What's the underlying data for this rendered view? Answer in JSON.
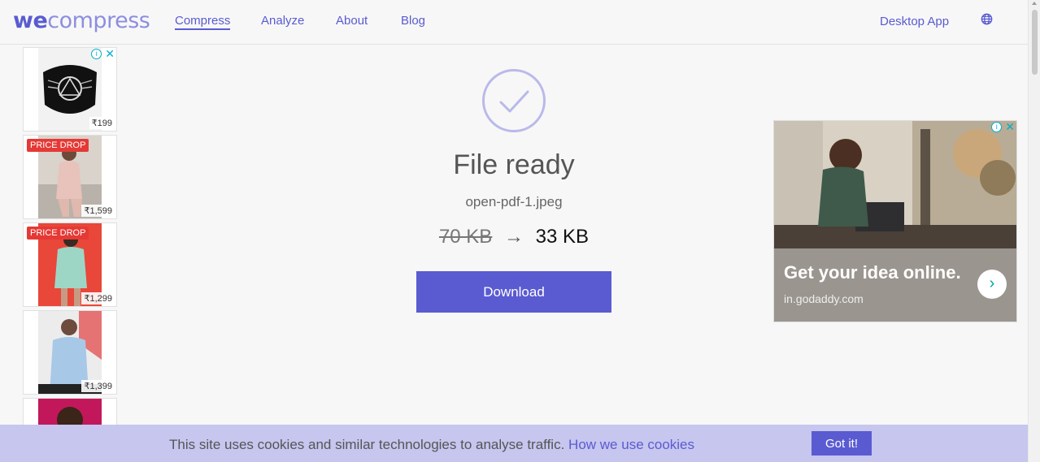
{
  "logo": {
    "part1": "we",
    "part2": "compress"
  },
  "nav": {
    "compress": "Compress",
    "analyze": "Analyze",
    "about": "About",
    "blog": "Blog",
    "desktop_app": "Desktop App"
  },
  "result": {
    "title": "File ready",
    "filename": "open-pdf-1.jpeg",
    "original_size": "70 KB",
    "arrow": "→",
    "compressed_size": "33 KB",
    "download_label": "Download"
  },
  "left_ads": [
    {
      "price": "₹199",
      "badge": ""
    },
    {
      "price": "₹1,599",
      "badge": "PRICE DROP"
    },
    {
      "price": "₹1,299",
      "badge": "PRICE DROP"
    },
    {
      "price": "₹1,399",
      "badge": ""
    }
  ],
  "right_ad": {
    "headline": "Get your idea online.",
    "domain": "in.godaddy.com",
    "cta_glyph": "›"
  },
  "ad_controls": {
    "info": "i",
    "close": "✕"
  },
  "cookie": {
    "text": "This site uses cookies and similar technologies to analyse traffic.",
    "link": "How we use cookies",
    "button": "Got it!"
  },
  "colors": {
    "accent": "#5a5bd1",
    "accent_light": "#8d8ee0",
    "cookie_bg": "#c6c6ef",
    "page_bg": "#f7f7f7"
  }
}
